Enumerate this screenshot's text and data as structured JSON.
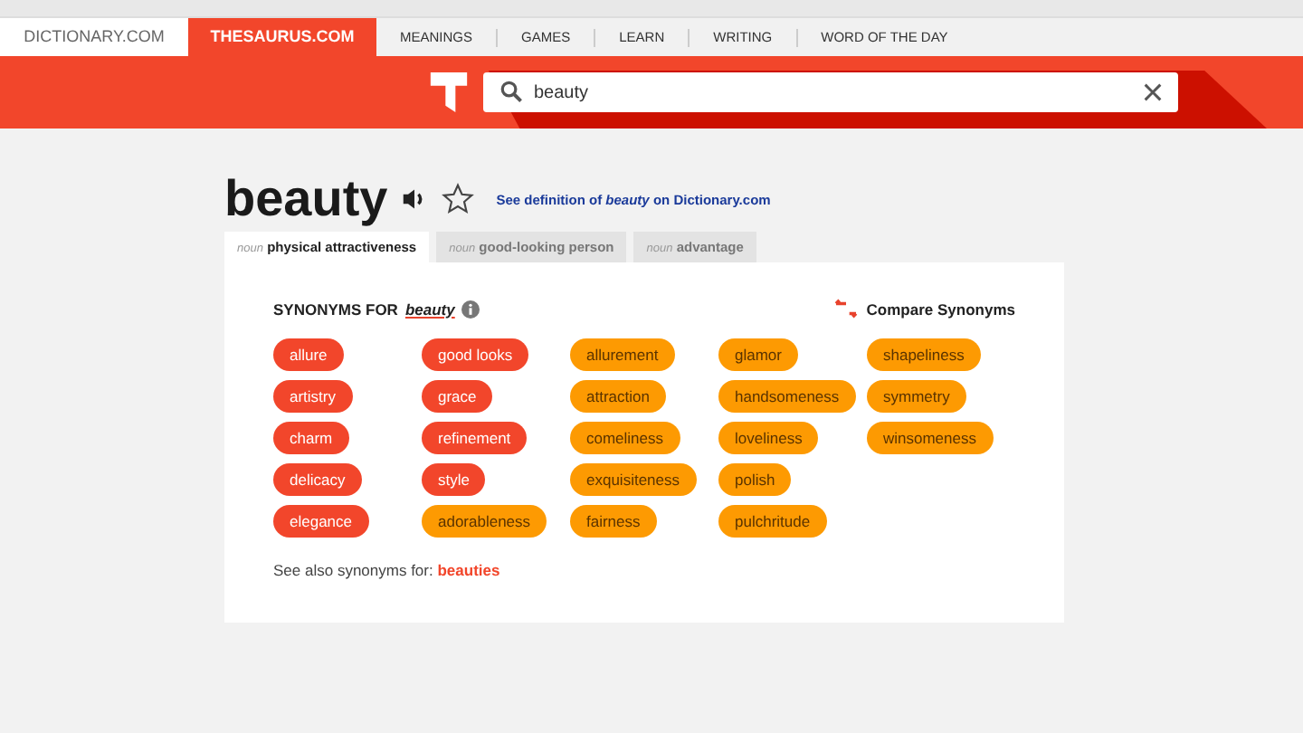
{
  "site_tabs": [
    {
      "label": "DICTIONARY.COM",
      "selected": false
    },
    {
      "label": "THESAURUS.COM",
      "selected": true
    }
  ],
  "nav_links": [
    "MEANINGS",
    "GAMES",
    "LEARN",
    "WRITING",
    "WORD OF THE DAY"
  ],
  "search": {
    "value": "beauty"
  },
  "headword": "beauty",
  "definition_link": "See definition of *beauty* on Dictionary.com",
  "sense_tabs": [
    {
      "pos": "noun",
      "label": "physical attractiveness",
      "selected": true
    },
    {
      "pos": "noun",
      "label": "good-looking person",
      "selected": false
    },
    {
      "pos": "noun",
      "label": "advantage",
      "selected": false
    }
  ],
  "synonyms_heading": "SYNONYMS FOR",
  "synonyms_word": "beauty",
  "compare": "Compare Synonyms",
  "synonym_columns": [
    [
      {
        "word": "allure",
        "kind": "strongest"
      },
      {
        "word": "artistry",
        "kind": "strongest"
      },
      {
        "word": "charm",
        "kind": "strongest"
      },
      {
        "word": "delicacy",
        "kind": "strongest"
      },
      {
        "word": "elegance",
        "kind": "strongest"
      }
    ],
    [
      {
        "word": "good looks",
        "kind": "strongest"
      },
      {
        "word": "grace",
        "kind": "strongest"
      },
      {
        "word": "refinement",
        "kind": "strongest"
      },
      {
        "word": "style",
        "kind": "strongest"
      },
      {
        "word": "adorableness",
        "kind": "strong"
      }
    ],
    [
      {
        "word": "allurement",
        "kind": "strong"
      },
      {
        "word": "attraction",
        "kind": "strong"
      },
      {
        "word": "comeliness",
        "kind": "strong"
      },
      {
        "word": "exquisiteness",
        "kind": "strong"
      },
      {
        "word": "fairness",
        "kind": "strong"
      }
    ],
    [
      {
        "word": "glamor",
        "kind": "strong"
      },
      {
        "word": "handsomeness",
        "kind": "strong"
      },
      {
        "word": "loveliness",
        "kind": "strong"
      },
      {
        "word": "polish",
        "kind": "strong"
      },
      {
        "word": "pulchritude",
        "kind": "strong"
      }
    ],
    [
      {
        "word": "shapeliness",
        "kind": "strong"
      },
      {
        "word": "symmetry",
        "kind": "strong"
      },
      {
        "word": "winsomeness",
        "kind": "strong"
      }
    ]
  ],
  "see_also": {
    "text": "See also synonyms for:",
    "link": "beauties"
  }
}
